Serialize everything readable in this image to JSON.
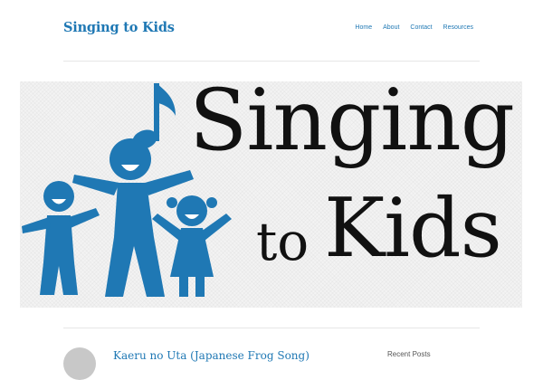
{
  "header": {
    "site_title": "Singing to Kids",
    "nav": [
      "Home",
      "About",
      "Contact",
      "Resources"
    ]
  },
  "hero": {
    "logo_words": {
      "line1": "Singing",
      "line2a": "to",
      "line2b": "Kids"
    },
    "icons": [
      "music-note-icon",
      "singing-children-figures-icon"
    ],
    "colors": {
      "figures": "#1f78b4",
      "text": "#111111",
      "background": "#f3f3f3"
    }
  },
  "main": {
    "post_title": "Kaeru no Uta (Japanese Frog Song)"
  },
  "sidebar": {
    "widget_title": "Recent Posts"
  },
  "colors": {
    "accent": "#1f78b4",
    "divider": "#e6e6e6"
  }
}
